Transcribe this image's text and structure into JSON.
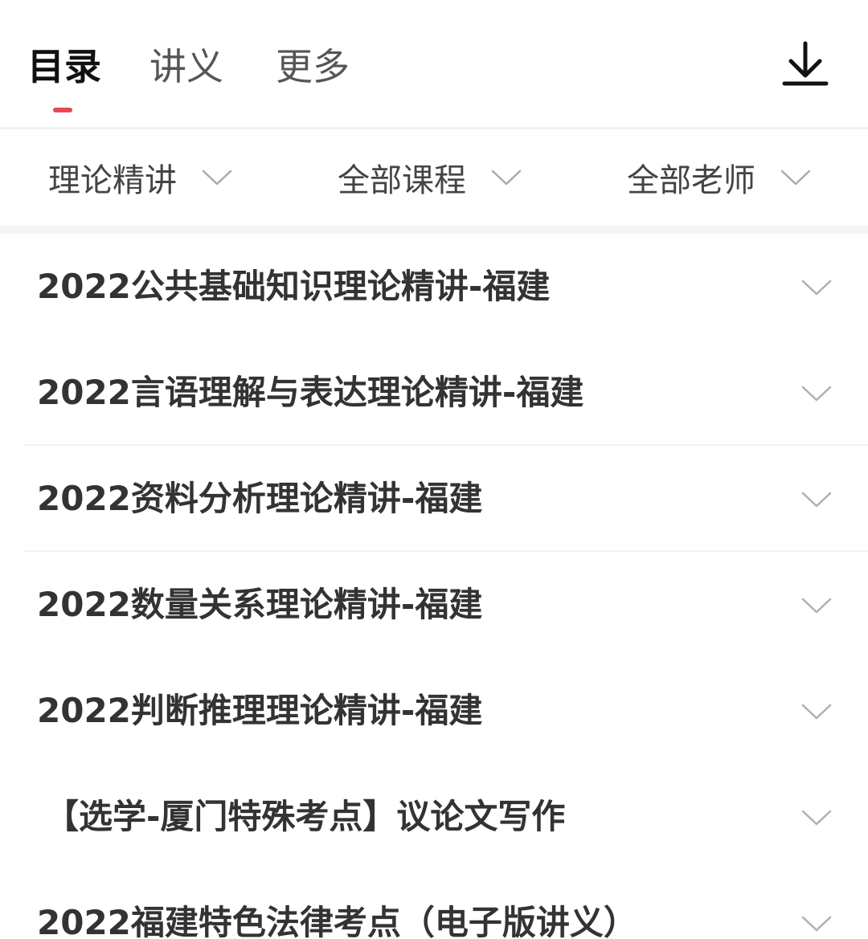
{
  "tabs": [
    {
      "label": "目录",
      "active": true
    },
    {
      "label": "讲义",
      "active": false
    },
    {
      "label": "更多",
      "active": false
    }
  ],
  "accent_color": "#e8474f",
  "download_icon": "download-icon",
  "filters": [
    {
      "label": "理论精讲",
      "icon": "chevron-down-icon"
    },
    {
      "label": "全部课程",
      "icon": "chevron-down-icon"
    },
    {
      "label": "全部老师",
      "icon": "chevron-down-icon"
    }
  ],
  "courses": [
    {
      "title": "2022公共基础知识理论精讲-福建"
    },
    {
      "title": "2022言语理解与表达理论精讲-福建"
    },
    {
      "title": "2022资料分析理论精讲-福建"
    },
    {
      "title": "2022数量关系理论精讲-福建"
    },
    {
      "title": "2022判断推理理论精讲-福建"
    },
    {
      "title": "【选学-厦门特殊考点】议论文写作"
    },
    {
      "title": "2022福建特色法律考点（电子版讲义）"
    }
  ]
}
